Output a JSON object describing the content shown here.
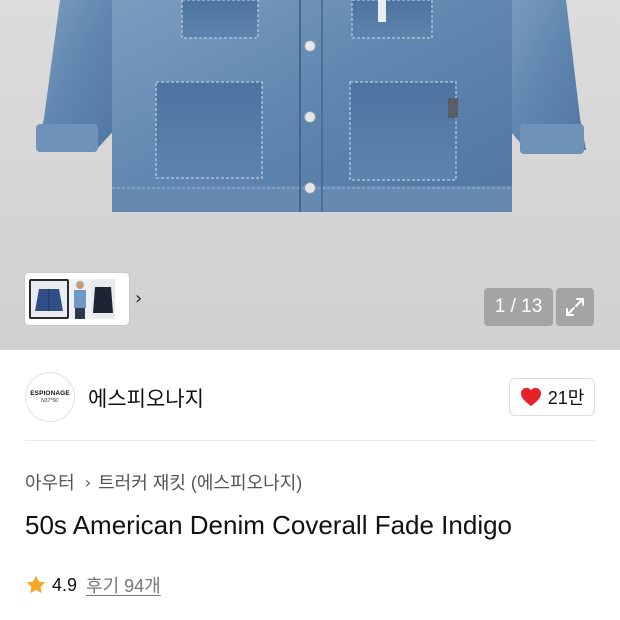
{
  "gallery": {
    "counter": "1 / 13"
  },
  "brand": {
    "logo_text": "ESPIONAGE",
    "logo_subtext": "N37°56'",
    "name": "에스피오나지",
    "like_count": "21만"
  },
  "breadcrumb": {
    "category": "아우터",
    "subcategory": "트러커 재킷 (에스피오나지)"
  },
  "product": {
    "title": "50s American Denim Coverall Fade Indigo",
    "rating": "4.9",
    "reviews": "후기 94개"
  },
  "colors": {
    "heart": "#e8202a",
    "star": "#f5a623",
    "denim": "#5d84ad"
  }
}
